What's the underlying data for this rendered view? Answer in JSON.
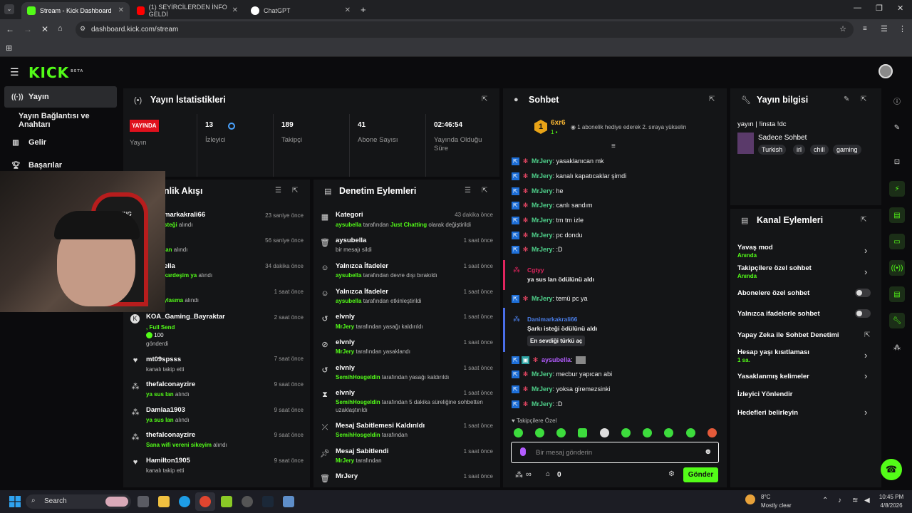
{
  "browser": {
    "tabs": [
      {
        "label": "Stream - Kick Dashboard",
        "active": true
      },
      {
        "label": "(1) SEYİRCİLERDEN İNFO GELDİ",
        "active": false
      },
      {
        "label": "ChatGPT",
        "active": false
      }
    ],
    "url": "dashboard.kick.com/stream",
    "new_tab": "+"
  },
  "kick": {
    "logo": "KICK",
    "beta": "BETA"
  },
  "sidebar": {
    "items": [
      {
        "label": "Yayın"
      },
      {
        "label": "Yayın Bağlantısı ve Anahtarı"
      },
      {
        "label": "Gelir"
      },
      {
        "label": "Başarılar"
      }
    ]
  },
  "stats": {
    "title": "Yayın İstatistikleri",
    "live_badge": "YAYINDA",
    "live_label": "Yayın",
    "items": [
      {
        "value": "13",
        "label": "İzleyici"
      },
      {
        "value": "189",
        "label": "Takipçi"
      },
      {
        "value": "41",
        "label": "Abone Sayısı"
      },
      {
        "value": "02:46:54",
        "label": "Yayında Olduğu Süre"
      }
    ]
  },
  "activity": {
    "title": "nlik Akışı",
    "rows": [
      {
        "name": "markakrali66",
        "sub": "steği",
        "sub2": "alındı",
        "time": "23 saniye önce"
      },
      {
        "name": "",
        "sub": "lan",
        "sub2": "alındı",
        "time": "56 saniye önce"
      },
      {
        "name": "ella",
        "sub": "kardeşim ya",
        "sub2": "alındı",
        "time": "34 dakika önce"
      },
      {
        "name": "",
        "sub": "ylasma",
        "sub2": "alındı",
        "time": "1 saat önce"
      },
      {
        "name": "KOA_Gaming_Bayraktar",
        "sub": ", Full Send",
        "amount": "100",
        "sub3": "gönderdi",
        "time": "2 saat önce"
      },
      {
        "name": "mt09spsss",
        "sub2": "kanalı takip etti",
        "time": "7 saat önce"
      },
      {
        "name": "thefalconayzire",
        "sub": "ya sus lan",
        "sub2": "alındı",
        "time": "9 saat önce"
      },
      {
        "name": "Damlaa1903",
        "sub": "ya sus lan",
        "sub2": "alındı",
        "time": "9 saat önce"
      },
      {
        "name": "thefalconayzire",
        "sub": "Sana wifi vereni sikeyim",
        "sub2": "alındı",
        "time": "9 saat önce"
      },
      {
        "name": "Hamilton1905",
        "sub2": "kanalı takip etti",
        "time": "9 saat önce"
      }
    ]
  },
  "moderation": {
    "title": "Denetim Eylemleri",
    "rows": [
      {
        "name": "Kategori",
        "user": "aysubella",
        "mid": "tarafından",
        "user2": "Just Chatting",
        "end": "olarak değiştirildi",
        "time": "43 dakika önce"
      },
      {
        "name": "aysubella",
        "end": "bir mesajı sildi",
        "time": "1 saat önce"
      },
      {
        "name": "Yalnızca İfadeler",
        "user": "aysubella",
        "end": "tarafından devre dışı bırakıldı",
        "time": "1 saat önce"
      },
      {
        "name": "Yalnızca İfadeler",
        "user": "aysubella",
        "end": "tarafından etkinleştirildi",
        "time": "1 saat önce"
      },
      {
        "name": "elvnly",
        "user": "MrJery",
        "end": "tarafından yasağı kaldırıldı",
        "time": "1 saat önce"
      },
      {
        "name": "elvnly",
        "user": "MrJery",
        "end": "tarafından yasaklandı",
        "time": "1 saat önce"
      },
      {
        "name": "elvnly",
        "user": "SemihHosgeldin",
        "end": "tarafından yasağı kaldırıldı",
        "time": "1 saat önce"
      },
      {
        "name": "elvnly",
        "user": "SemihHosgeldin",
        "end": "tarafından 5 dakika süreliğine sohbetten",
        "end2": "uzaklaştırıldı",
        "time": "1 saat önce"
      },
      {
        "name": "Mesaj Sabitlemesi Kaldırıldı",
        "user": "SemihHosgeldin",
        "end": "tarafından",
        "time": "1 saat önce"
      },
      {
        "name": "Mesaj Sabitlendi",
        "user": "MrJery",
        "end": "tarafından",
        "time": "1 saat önce"
      },
      {
        "name": "MrJery",
        "time": "1 saat önce"
      }
    ]
  },
  "chat": {
    "title": "Sohbet",
    "top_gifter": "6xr6",
    "top_count": "1",
    "gift_note": "1 abonelik hediye ederek 2. sıraya yükselin",
    "messages": [
      {
        "user": "MrJery",
        "text": ": yasaklanıcan mk"
      },
      {
        "user": "MrJery",
        "text": ": kanalı kapatıcaklar şimdi"
      },
      {
        "user": "MrJery",
        "text": ": he"
      },
      {
        "user": "MrJery",
        "text": ": canlı sandım"
      },
      {
        "user": "MrJery",
        "text": ": tm tm izle"
      },
      {
        "user": "MrJery",
        "text": ": pc dondu"
      },
      {
        "user": "MrJery",
        "text": ": :D"
      }
    ],
    "reward1": {
      "user": "Cgtyy",
      "text": "ya sus lan ödülünü aldı"
    },
    "msg_after": {
      "user": "MrJery",
      "text": ": temü pc ya"
    },
    "reward2": {
      "user": "Danimarkakrali66",
      "text": "Şarkı isteği ödülünü aldı",
      "tag": "En sevdiği türkü aç"
    },
    "messages2": [
      {
        "user": "aysubella",
        "text": ":"
      },
      {
        "user": "MrJery",
        "text": ": mecbur yapıcan abi"
      },
      {
        "user": "MrJery",
        "text": ": yoksa giremezsinki"
      },
      {
        "user": "MrJery",
        "text": ": :D"
      }
    ],
    "followers_only": "Takipçilere Özel",
    "input_placeholder": "Bir mesaj gönderin",
    "counter": "0",
    "send": "Gönder"
  },
  "info": {
    "title": "Yayın bilgisi",
    "stream_title": "yayın | !insta !dc",
    "category": "Sadece Sohbet",
    "tags": [
      "Turkish",
      "irl",
      "chill",
      "gaming"
    ]
  },
  "channel": {
    "title": "Kanal Eylemleri",
    "rows": [
      {
        "label": "Yavaş mod",
        "sub": "Anında",
        "control": "chevron"
      },
      {
        "label": "Takipçilere özel sohbet",
        "sub": "Anında",
        "control": "chevron"
      },
      {
        "label": "Abonelere özel sohbet",
        "control": "toggle"
      },
      {
        "label": "Yalnızca ifadelerle sohbet",
        "control": "toggle"
      },
      {
        "label": "Yapay Zeka ile Sohbet Denetimi",
        "control": "external"
      },
      {
        "label": "Hesap yaşı kısıtlaması",
        "sub": "1 sa.",
        "control": "chevron"
      },
      {
        "label": "Yasaklanmış kelimeler",
        "control": "chevron"
      },
      {
        "label": "İzleyici Yönlendir",
        "control": "none"
      },
      {
        "label": "Hedefleri belirleyin",
        "control": "chevron"
      }
    ]
  },
  "taskbar": {
    "search": "Search",
    "weather_temp": "8°C",
    "weather_desc": "Mostly clear",
    "time": "10:45 PM",
    "date": "4/8/2026"
  },
  "colors": {
    "accent": "#53fc18",
    "live": "#e0111d",
    "panel": "#141517",
    "bg": "#0b0b0d"
  }
}
